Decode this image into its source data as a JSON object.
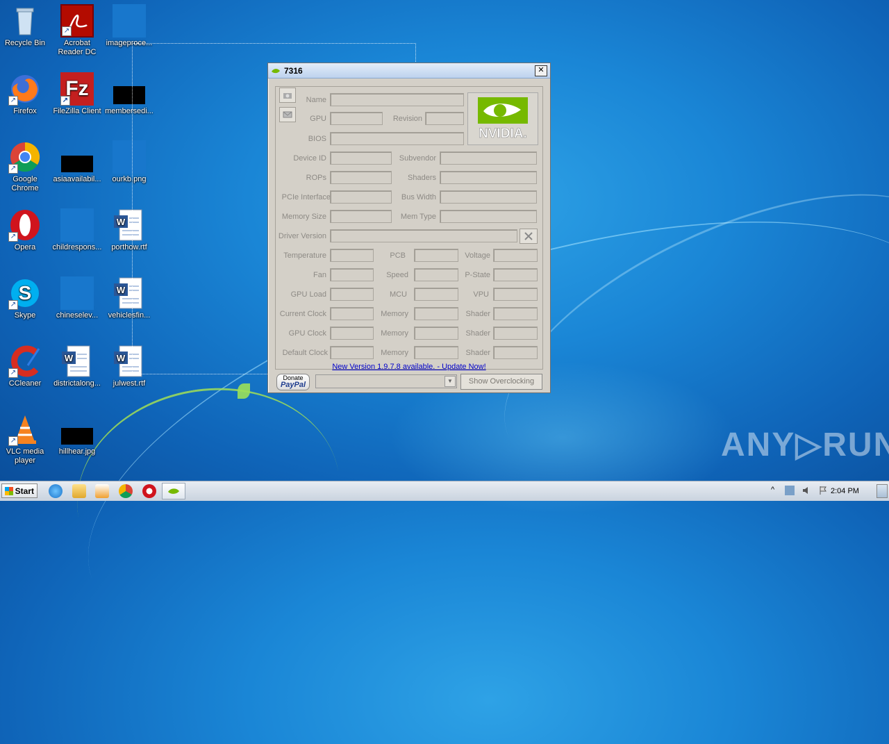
{
  "desktop": {
    "icons": [
      {
        "label": "Recycle Bin"
      },
      {
        "label": "Acrobat\nReader DC"
      },
      {
        "label": "imageproce..."
      },
      {
        "label": "Firefox"
      },
      {
        "label": "FileZilla Client"
      },
      {
        "label": "membersedi..."
      },
      {
        "label": "Google\nChrome"
      },
      {
        "label": "asiaavailabil..."
      },
      {
        "label": "ourkb.png"
      },
      {
        "label": "Opera"
      },
      {
        "label": "childrespons..."
      },
      {
        "label": "porthow.rtf"
      },
      {
        "label": "Skype"
      },
      {
        "label": "chineselev..."
      },
      {
        "label": "vehiclesfin..."
      },
      {
        "label": "CCleaner"
      },
      {
        "label": "districtalong..."
      },
      {
        "label": "julwest.rtf"
      },
      {
        "label": "VLC media\nplayer"
      },
      {
        "label": "hillhear.jpg"
      }
    ]
  },
  "window": {
    "title": "7316",
    "close_glyph": "✕",
    "labels": {
      "name": "Name",
      "gpu": "GPU",
      "revision": "Revision",
      "bios": "BIOS",
      "device_id": "Device ID",
      "subvendor": "Subvendor",
      "rops": "ROPs",
      "shaders": "Shaders",
      "pcie": "PCIe Interface",
      "bus_width": "Bus Width",
      "memory_size": "Memory Size",
      "mem_type": "Mem Type",
      "driver_version": "Driver Version",
      "temperature": "Temperature",
      "pcb": "PCB",
      "voltage": "Voltage",
      "fan": "Fan",
      "speed": "Speed",
      "pstate": "P-State",
      "gpu_load": "GPU Load",
      "mcu": "MCU",
      "vpu": "VPU",
      "current_clock": "Current Clock",
      "memory1": "Memory",
      "shader1": "Shader",
      "gpu_clock": "GPU Clock",
      "memory2": "Memory",
      "shader2": "Shader",
      "default_clock": "Default Clock",
      "memory3": "Memory",
      "shader3": "Shader"
    },
    "nvidia_text": "NVIDIA.",
    "update_link": "New Version 1.9.7.8 available. - Update Now!",
    "paypal_top": "Donate",
    "paypal_brand": "PayPal",
    "overclock_button": "Show Overclocking"
  },
  "taskbar": {
    "start_label": "Start",
    "clock": "2:04 PM"
  },
  "watermark": "ANY▷RUN"
}
